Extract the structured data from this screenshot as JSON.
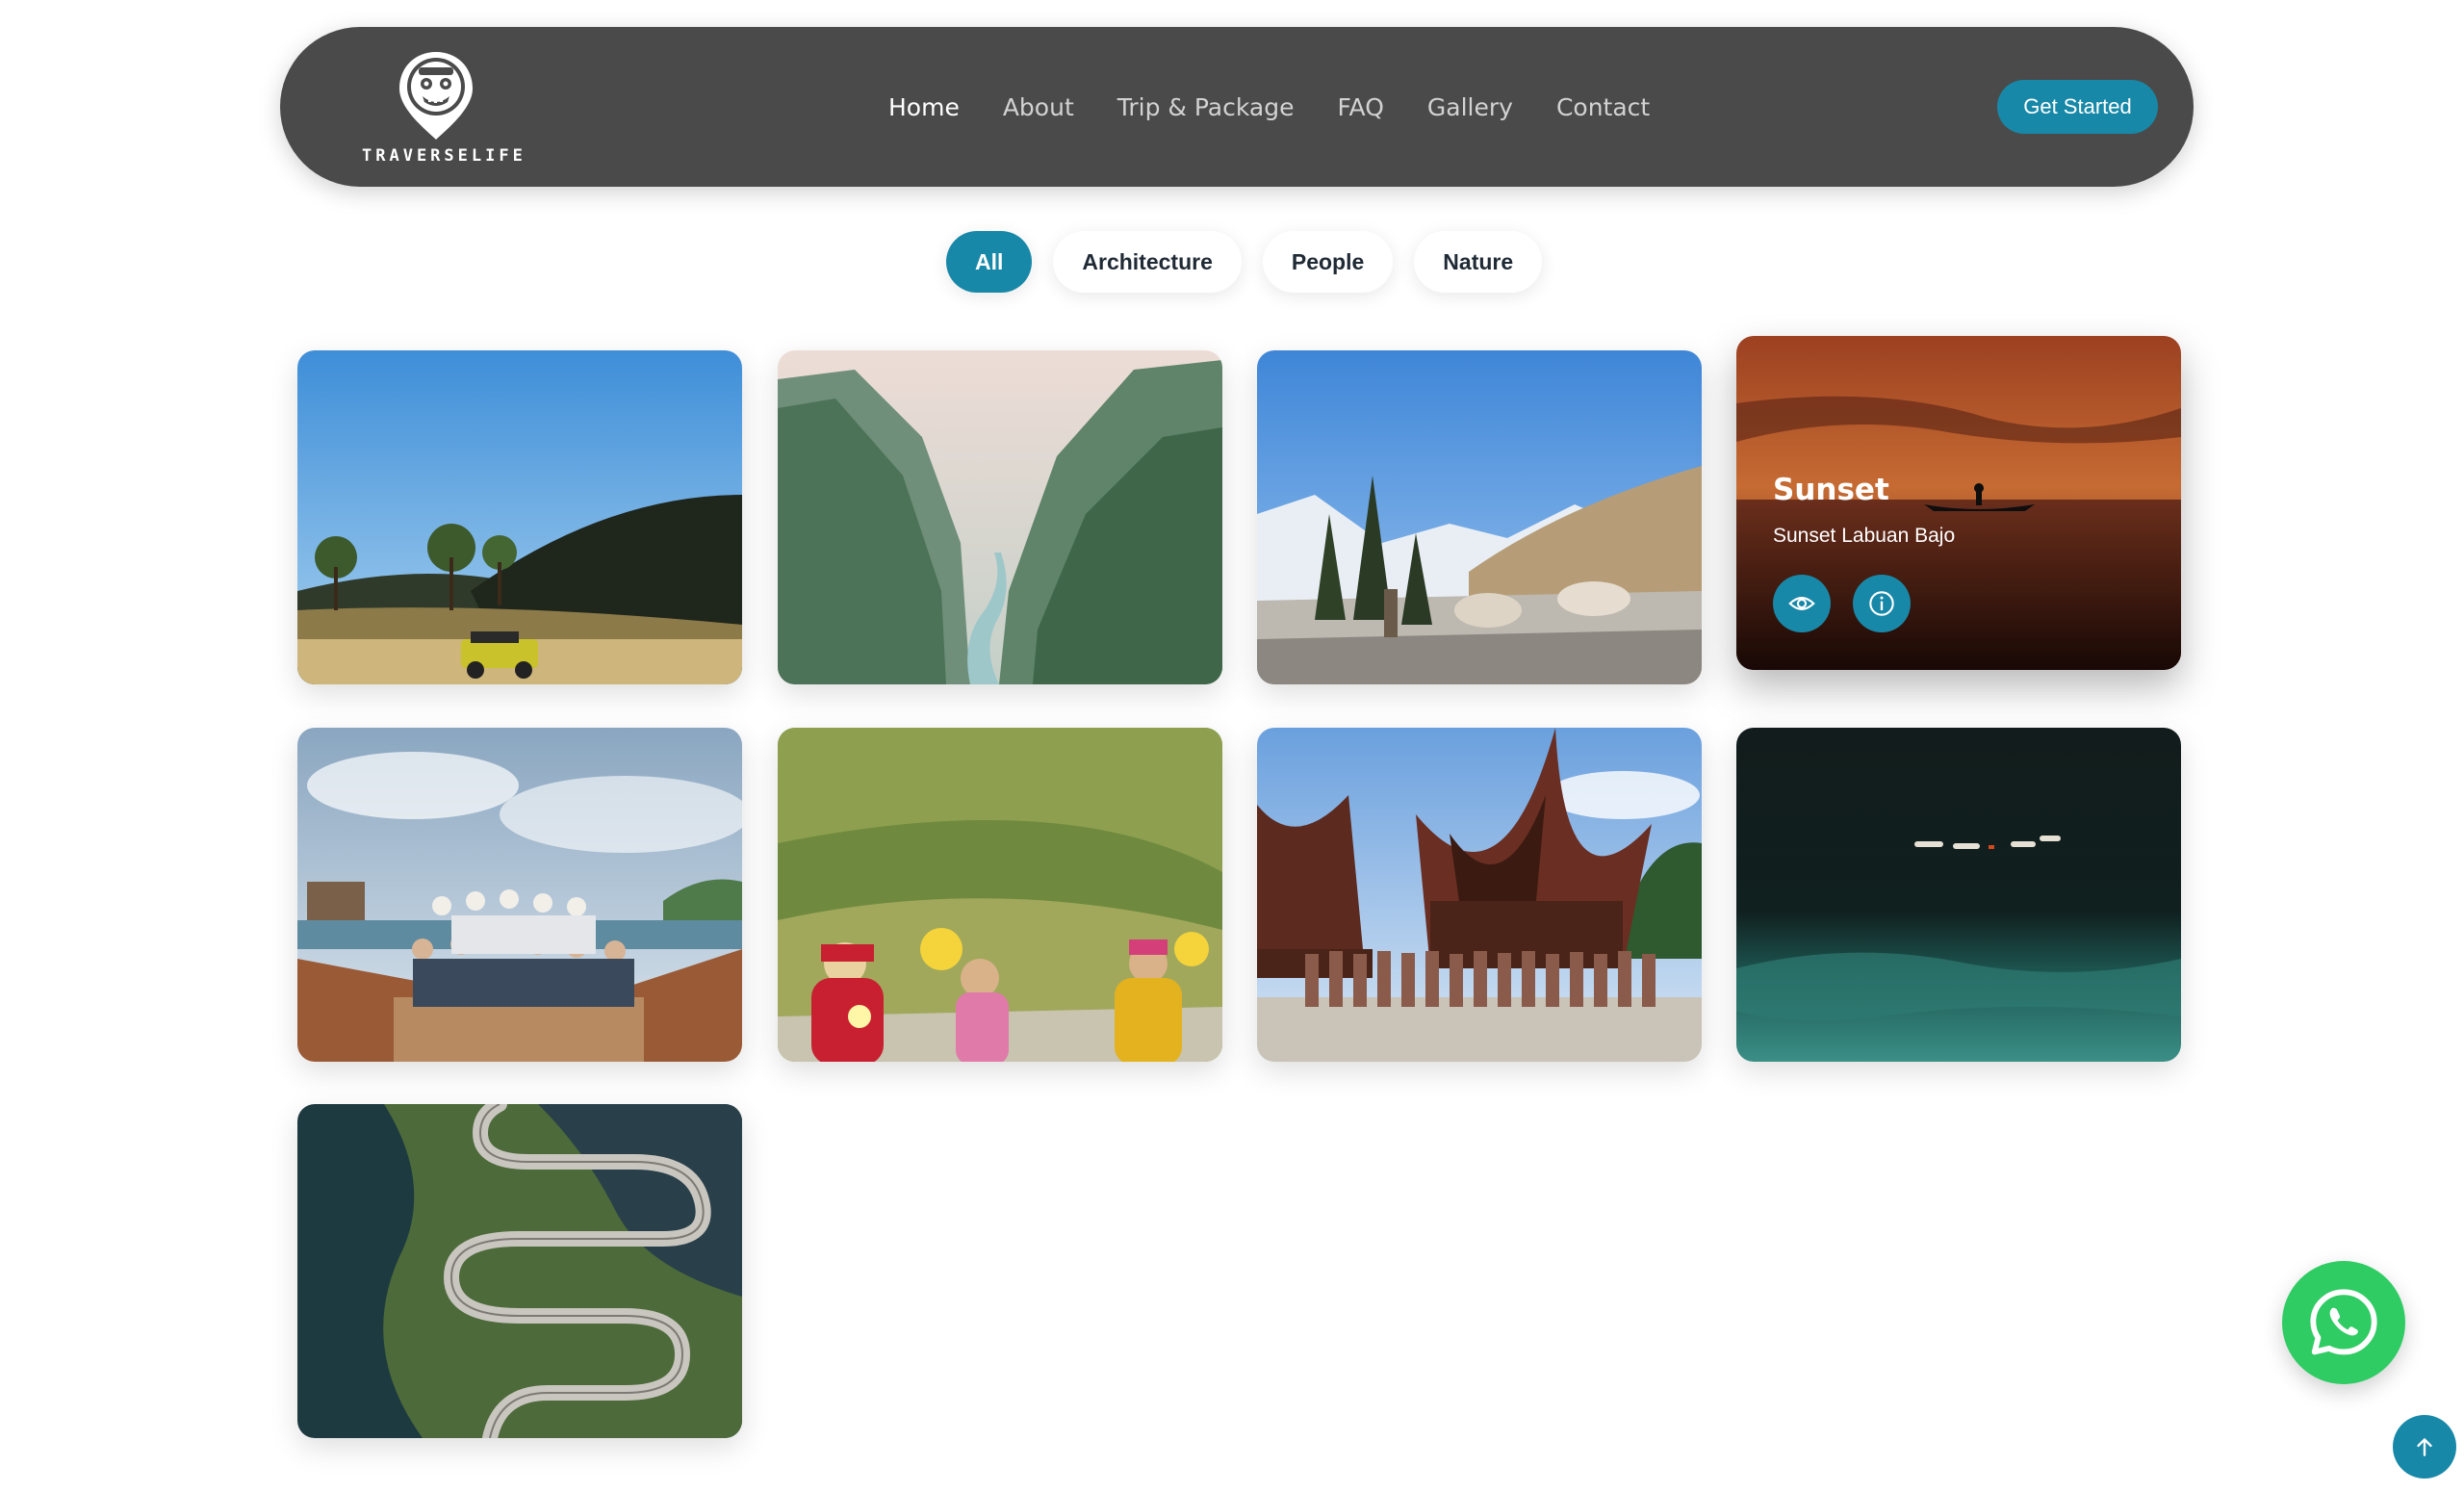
{
  "brand": {
    "name": "TRAVERSELIFE",
    "logo_icon": "mask-pin-logo"
  },
  "nav": {
    "links": [
      {
        "label": "Home",
        "active": true
      },
      {
        "label": "About"
      },
      {
        "label": "Trip & Package"
      },
      {
        "label": "FAQ"
      },
      {
        "label": "Gallery"
      },
      {
        "label": "Contact"
      }
    ],
    "cta_label": "Get Started"
  },
  "filters": [
    {
      "label": "All",
      "active": true
    },
    {
      "label": "Architecture"
    },
    {
      "label": "People"
    },
    {
      "label": "Nature"
    }
  ],
  "gallery": {
    "hovered_item": {
      "title": "Sunset",
      "subtitle": "Sunset Labuan Bajo",
      "actions": [
        "eye-icon",
        "info-icon"
      ]
    }
  },
  "floating": {
    "whatsapp_icon": "whatsapp-icon",
    "scroll_top_icon": "arrow-up-icon"
  },
  "colors": {
    "accent": "#1888a8",
    "navbar": "#4a4a4a",
    "whatsapp": "#2fcb63"
  }
}
